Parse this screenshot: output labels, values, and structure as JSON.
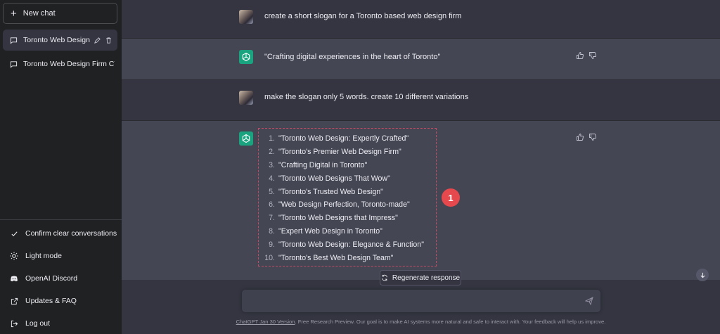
{
  "sidebar": {
    "new_chat": "New chat",
    "conversations": [
      {
        "title": "Toronto Web Design Sl"
      },
      {
        "title": "Toronto Web Design Firm CTA"
      }
    ],
    "menu": [
      {
        "label": "Confirm clear conversations",
        "icon": "check-icon"
      },
      {
        "label": "Light mode",
        "icon": "sun-icon"
      },
      {
        "label": "OpenAI Discord",
        "icon": "discord-icon"
      },
      {
        "label": "Updates & FAQ",
        "icon": "external-link-icon"
      },
      {
        "label": "Log out",
        "icon": "logout-icon"
      }
    ]
  },
  "chat": {
    "messages": [
      {
        "role": "user",
        "text": "create a short slogan for a Toronto based web design firm"
      },
      {
        "role": "assistant",
        "text": "\"Crafting digital experiences in the heart of Toronto\""
      },
      {
        "role": "user",
        "text": "make the slogan only 5 words. create 10 different variations"
      }
    ],
    "variations": [
      {
        "num": "1.",
        "text": "\"Toronto Web Design: Expertly Crafted\""
      },
      {
        "num": "2.",
        "text": "\"Toronto's Premier Web Design Firm\""
      },
      {
        "num": "3.",
        "text": "\"Crafting Digital in Toronto\""
      },
      {
        "num": "4.",
        "text": "\"Toronto Web Designs That Wow\""
      },
      {
        "num": "5.",
        "text": "\"Toronto's Trusted Web Design\""
      },
      {
        "num": "6.",
        "text": "\"Web Design Perfection, Toronto-made\""
      },
      {
        "num": "7.",
        "text": "\"Toronto Web Designs that Impress\""
      },
      {
        "num": "8.",
        "text": "\"Expert Web Design in Toronto\""
      },
      {
        "num": "9.",
        "text": "\"Toronto Web Design: Elegance & Function\""
      },
      {
        "num": "10.",
        "text": "\"Toronto's Best Web Design Team\""
      }
    ],
    "annotation_badge": "1"
  },
  "composer": {
    "regenerate": "Regenerate response",
    "input_value": "",
    "footer_link": "ChatGPT Jan 30 Version",
    "footer_text": ". Free Research Preview. Our goal is to make AI systems more natural and safe to interact with. Your feedback will help us improve."
  },
  "colors": {
    "sidebar_bg": "#202123",
    "user_bg": "#343541",
    "assistant_bg": "#444654",
    "bot_avatar": "#19a37f",
    "annotation_red": "#e5484d"
  }
}
